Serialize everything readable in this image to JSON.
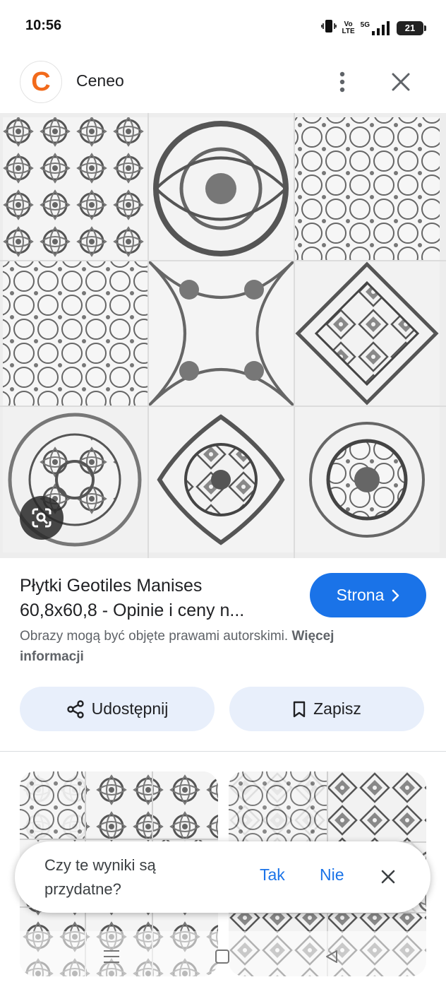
{
  "status_bar": {
    "time": "10:56",
    "volte_line1": "Vo",
    "volte_line2": "LTE",
    "network": "5G",
    "battery": "21"
  },
  "header": {
    "site_logo_letter": "C",
    "site_name": "Ceneo",
    "icons": {
      "more": "more-vert-icon",
      "close": "close-icon"
    }
  },
  "result": {
    "title_line1": "Płytki Geotiles Manises",
    "title_line2": "60,8x60,8 - Opinie i ceny n...",
    "visit_button": "Strona",
    "copyright_text": "Obrazy mogą być objęte prawami autorskimi.",
    "copyright_link": "Więcej informacji",
    "share_button": "Udostępnij",
    "save_button": "Zapisz"
  },
  "feedback": {
    "question": "Czy te wyniki są przydatne?",
    "yes": "Tak",
    "no": "Nie"
  },
  "colors": {
    "accent": "#1a73e8",
    "button_bg": "#e8effb",
    "logo": "#f26a1b"
  }
}
